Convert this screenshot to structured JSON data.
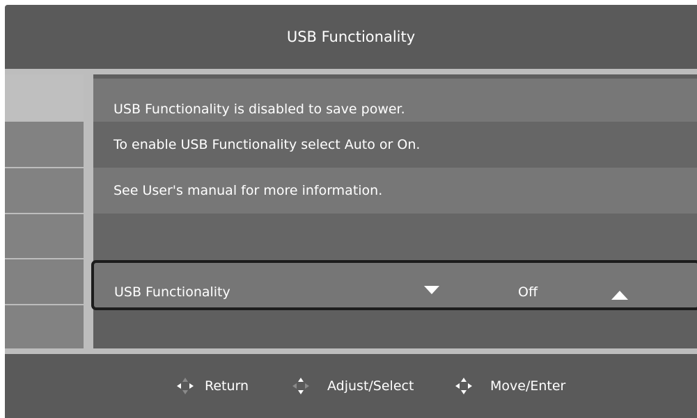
{
  "header": {
    "title": "USB Functionality"
  },
  "sidebar": {
    "items": [
      {
        "active": true
      },
      {
        "active": false
      },
      {
        "active": false
      },
      {
        "active": false
      },
      {
        "active": false
      },
      {
        "active": false
      }
    ]
  },
  "content": {
    "lines": [
      "USB Functionality is disabled to save power.",
      "To enable USB Functionality select Auto or On.",
      "See User's manual for more information."
    ],
    "setting": {
      "label": "USB Functionality",
      "value": "Off"
    }
  },
  "footer": {
    "hints": [
      {
        "label": "Return",
        "icon": "dpad-left-icon"
      },
      {
        "label": "Adjust/Select",
        "icon": "dpad-updown-icon"
      },
      {
        "label": "Move/Enter",
        "icon": "dpad-all-icon"
      }
    ]
  },
  "colors": {
    "frame": "#bdbdbd",
    "bar": "#5a5a5a",
    "row_light": "#777777",
    "row_dark": "#666666",
    "selection_border": "#1c1c1c"
  }
}
